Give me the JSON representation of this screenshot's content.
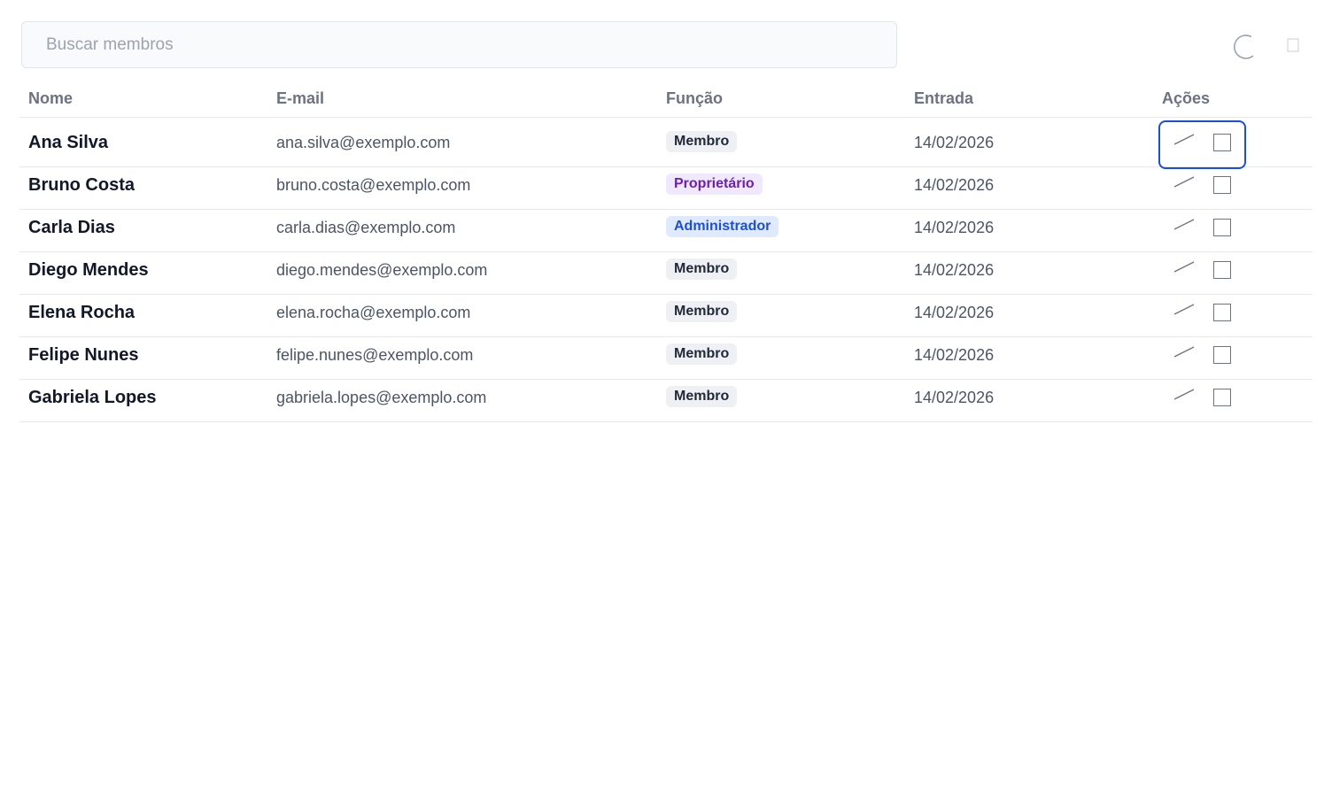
{
  "search": {
    "placeholder": "Buscar membros",
    "value": ""
  },
  "toolbar": {
    "refresh_icon": "refresh-icon",
    "export_icon": "export-icon"
  },
  "table": {
    "headers": {
      "name": "Nome",
      "email": "E-mail",
      "role": "Função",
      "joined": "Entrada",
      "actions": "Ações"
    },
    "rows": [
      {
        "name": "Ana Silva",
        "email": "ana.silva@exemplo.com",
        "role": "Membro",
        "role_type": "member",
        "joined": "14/02/2026"
      },
      {
        "name": "Bruno Costa",
        "email": "bruno.costa@exemplo.com",
        "role": "Proprietário",
        "role_type": "owner",
        "joined": "14/02/2026"
      },
      {
        "name": "Carla Dias",
        "email": "carla.dias@exemplo.com",
        "role": "Administrador",
        "role_type": "admin",
        "joined": "14/02/2026"
      },
      {
        "name": "Diego Mendes",
        "email": "diego.mendes@exemplo.com",
        "role": "Membro",
        "role_type": "member",
        "joined": "14/02/2026"
      },
      {
        "name": "Elena Rocha",
        "email": "elena.rocha@exemplo.com",
        "role": "Membro",
        "role_type": "member",
        "joined": "14/02/2026"
      },
      {
        "name": "Felipe Nunes",
        "email": "felipe.nunes@exemplo.com",
        "role": "Membro",
        "role_type": "member",
        "joined": "14/02/2026"
      },
      {
        "name": "Gabriela Lopes",
        "email": "gabriela.lopes@exemplo.com",
        "role": "Membro",
        "role_type": "member",
        "joined": "14/02/2026"
      }
    ]
  },
  "colors": {
    "focus_ring": "#1d4ed8",
    "owner_badge_bg": "#f0e8fd",
    "owner_badge_text": "#6b21a8",
    "admin_badge_bg": "#e0eafe",
    "admin_badge_text": "#1d4ed8",
    "member_badge_bg": "#eef0f3"
  }
}
